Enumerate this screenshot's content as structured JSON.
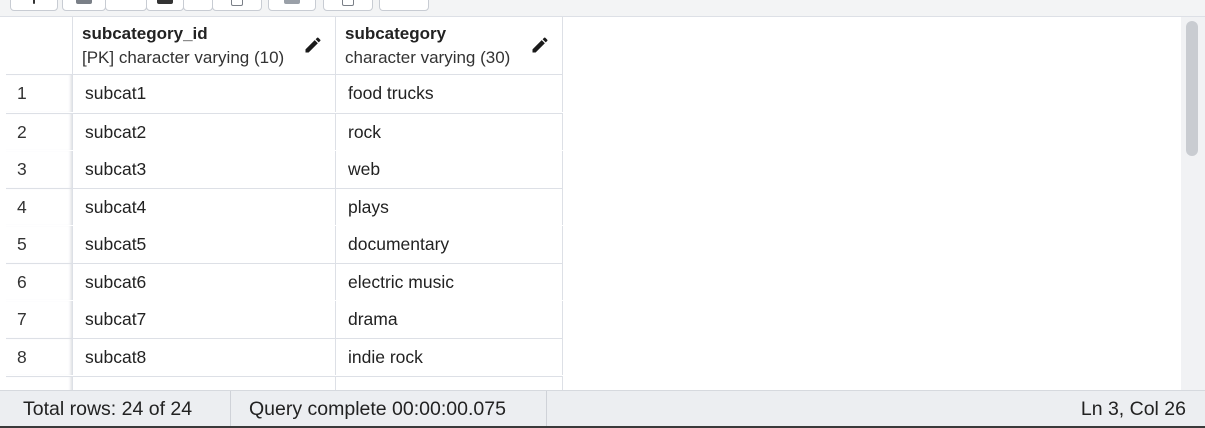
{
  "columns": [
    {
      "name": "subcategory_id",
      "type": "[PK] character varying (10)"
    },
    {
      "name": "subcategory",
      "type": "character varying (30)"
    }
  ],
  "rows": [
    {
      "n": "1",
      "id": "subcat1",
      "sub": "food trucks"
    },
    {
      "n": "2",
      "id": "subcat2",
      "sub": "rock"
    },
    {
      "n": "3",
      "id": "subcat3",
      "sub": "web"
    },
    {
      "n": "4",
      "id": "subcat4",
      "sub": "plays"
    },
    {
      "n": "5",
      "id": "subcat5",
      "sub": "documentary"
    },
    {
      "n": "6",
      "id": "subcat6",
      "sub": "electric music"
    },
    {
      "n": "7",
      "id": "subcat7",
      "sub": "drama"
    },
    {
      "n": "8",
      "id": "subcat8",
      "sub": "indie rock"
    }
  ],
  "status": {
    "total_rows": "Total rows: 24 of 24",
    "query": "Query complete 00:00:00.075",
    "cursor": "Ln 3, Col 26"
  },
  "icons": {
    "edit": "pencil-icon"
  }
}
